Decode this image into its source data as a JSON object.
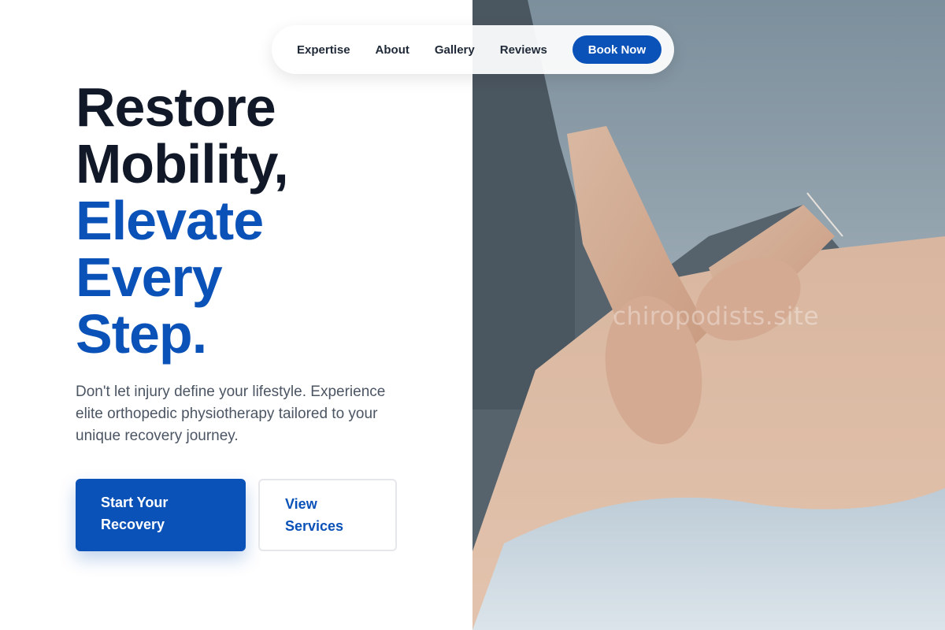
{
  "nav": {
    "items": [
      {
        "label": "Expertise"
      },
      {
        "label": "About"
      },
      {
        "label": "Gallery"
      },
      {
        "label": "Reviews"
      }
    ],
    "cta_label": "Book Now"
  },
  "hero": {
    "headline_line1": "Restore",
    "headline_line2": "Mobility,",
    "headline_line3": "Elevate",
    "headline_line4": "Every",
    "headline_line5": "Step.",
    "subtext": "Don't let injury define your lifestyle. Experience elite orthopedic physiotherapy tailored to your unique recovery journey.",
    "primary_button": "Start Your Recovery",
    "secondary_button": "View Services",
    "image_watermark": "chiropodists.site"
  },
  "colors": {
    "accent": "#0a52b8",
    "heading_dark": "#111827",
    "body_text": "#4b5563"
  }
}
